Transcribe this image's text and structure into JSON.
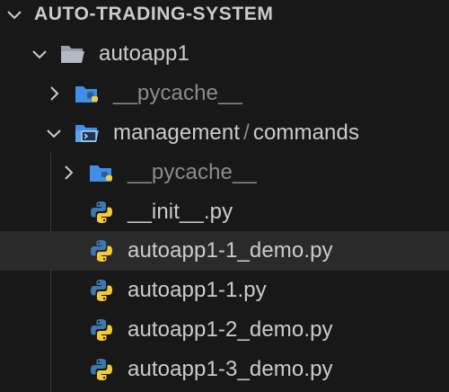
{
  "explorer": {
    "root": {
      "label": "AUTO-TRADING-SYSTEM",
      "expanded": true
    },
    "items": [
      {
        "label": "autoapp1",
        "type": "folder-open",
        "expanded": true
      },
      {
        "label": "__pycache__",
        "type": "folder-python",
        "expanded": false,
        "dim": true
      },
      {
        "label_part1": "management",
        "separator": "/",
        "label_part2": "commands",
        "type": "folder-terminal",
        "expanded": true
      },
      {
        "label": "__pycache__",
        "type": "folder-python",
        "expanded": false,
        "dim": true
      },
      {
        "label": "__init__.py",
        "type": "python-file"
      },
      {
        "label": "autoapp1-1_demo.py",
        "type": "python-file",
        "hovered": true
      },
      {
        "label": "autoapp1-1.py",
        "type": "python-file"
      },
      {
        "label": "autoapp1-2_demo.py",
        "type": "python-file"
      },
      {
        "label": "autoapp1-3_demo.py",
        "type": "python-file"
      }
    ]
  },
  "colors": {
    "background": "#181818",
    "hover": "#2a2a2b",
    "text": "#cccccc",
    "text_dim": "#8c8c8c",
    "python_blue": "#3b78b0",
    "python_yellow": "#f5c93a",
    "folder_grey": "#b4b9c2",
    "folder_blue": "#3f8ee8"
  },
  "icons": {
    "chevron_down": "chevron-down-icon",
    "chevron_right": "chevron-right-icon",
    "folder_open": "folder-open-icon",
    "folder_python": "python-folder-icon",
    "folder_terminal": "terminal-folder-icon",
    "python_file": "python-file-icon"
  }
}
